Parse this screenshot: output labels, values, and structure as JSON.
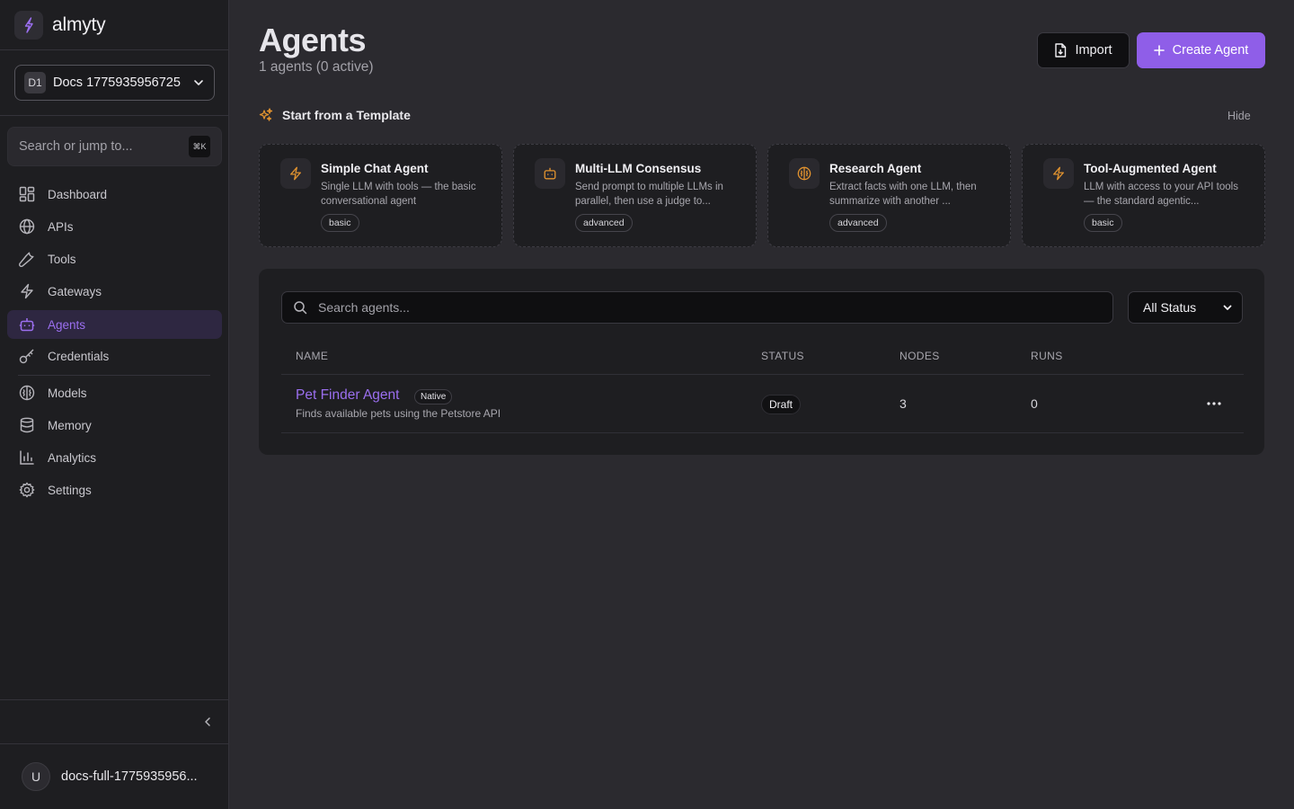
{
  "brand": {
    "name": "almyty"
  },
  "workspace": {
    "badge": "D1",
    "name": "Docs 1775935956725"
  },
  "sidebar_search": {
    "placeholder": "Search or jump to...",
    "shortcut": "⌘K"
  },
  "nav": {
    "items": [
      {
        "label": "Dashboard",
        "icon": "dashboard-icon"
      },
      {
        "label": "APIs",
        "icon": "globe-icon"
      },
      {
        "label": "Tools",
        "icon": "wrench-icon"
      },
      {
        "label": "Gateways",
        "icon": "lightning-icon"
      },
      {
        "label": "Agents",
        "icon": "bot-icon",
        "active": true
      },
      {
        "label": "Credentials",
        "icon": "key-icon"
      },
      {
        "label": "Models",
        "icon": "brain-icon"
      },
      {
        "label": "Memory",
        "icon": "database-icon"
      },
      {
        "label": "Analytics",
        "icon": "bar-chart-icon"
      },
      {
        "label": "Settings",
        "icon": "gear-icon"
      }
    ]
  },
  "user": {
    "initial": "U",
    "name": "docs-full-1775935956..."
  },
  "page": {
    "title": "Agents",
    "subtitle": "1 agents (0 active)"
  },
  "actions": {
    "import_label": "Import",
    "create_label": "Create Agent"
  },
  "templates": {
    "title": "Start from a Template",
    "hide_label": "Hide",
    "cards": [
      {
        "name": "Simple Chat Agent",
        "description": "Single LLM with tools — the basic conversational agent",
        "tag": "basic",
        "icon": "lightning-icon"
      },
      {
        "name": "Multi-LLM Consensus",
        "description": "Send prompt to multiple LLMs in parallel, then use a judge to...",
        "tag": "advanced",
        "icon": "bot-icon"
      },
      {
        "name": "Research Agent",
        "description": "Extract facts with one LLM, then summarize with another ...",
        "tag": "advanced",
        "icon": "brain-icon"
      },
      {
        "name": "Tool-Augmented Agent",
        "description": "LLM with access to your API tools — the standard agentic...",
        "tag": "basic",
        "icon": "lightning-icon"
      }
    ]
  },
  "agents_table": {
    "search_placeholder": "Search agents...",
    "status_filter": "All Status",
    "columns": [
      "NAME",
      "STATUS",
      "NODES",
      "RUNS"
    ],
    "rows": [
      {
        "name": "Pet Finder Agent",
        "badge": "Native",
        "description": "Finds available pets using the Petstore API",
        "status": "Draft",
        "nodes": "3",
        "runs": "0"
      }
    ]
  },
  "colors": {
    "accent": "#8f5ee8",
    "accent_text": "#9b6ff0",
    "template_icon": "#e0922f",
    "sidebar_bg": "#1e1e21",
    "main_bg": "#2b2a2f"
  }
}
